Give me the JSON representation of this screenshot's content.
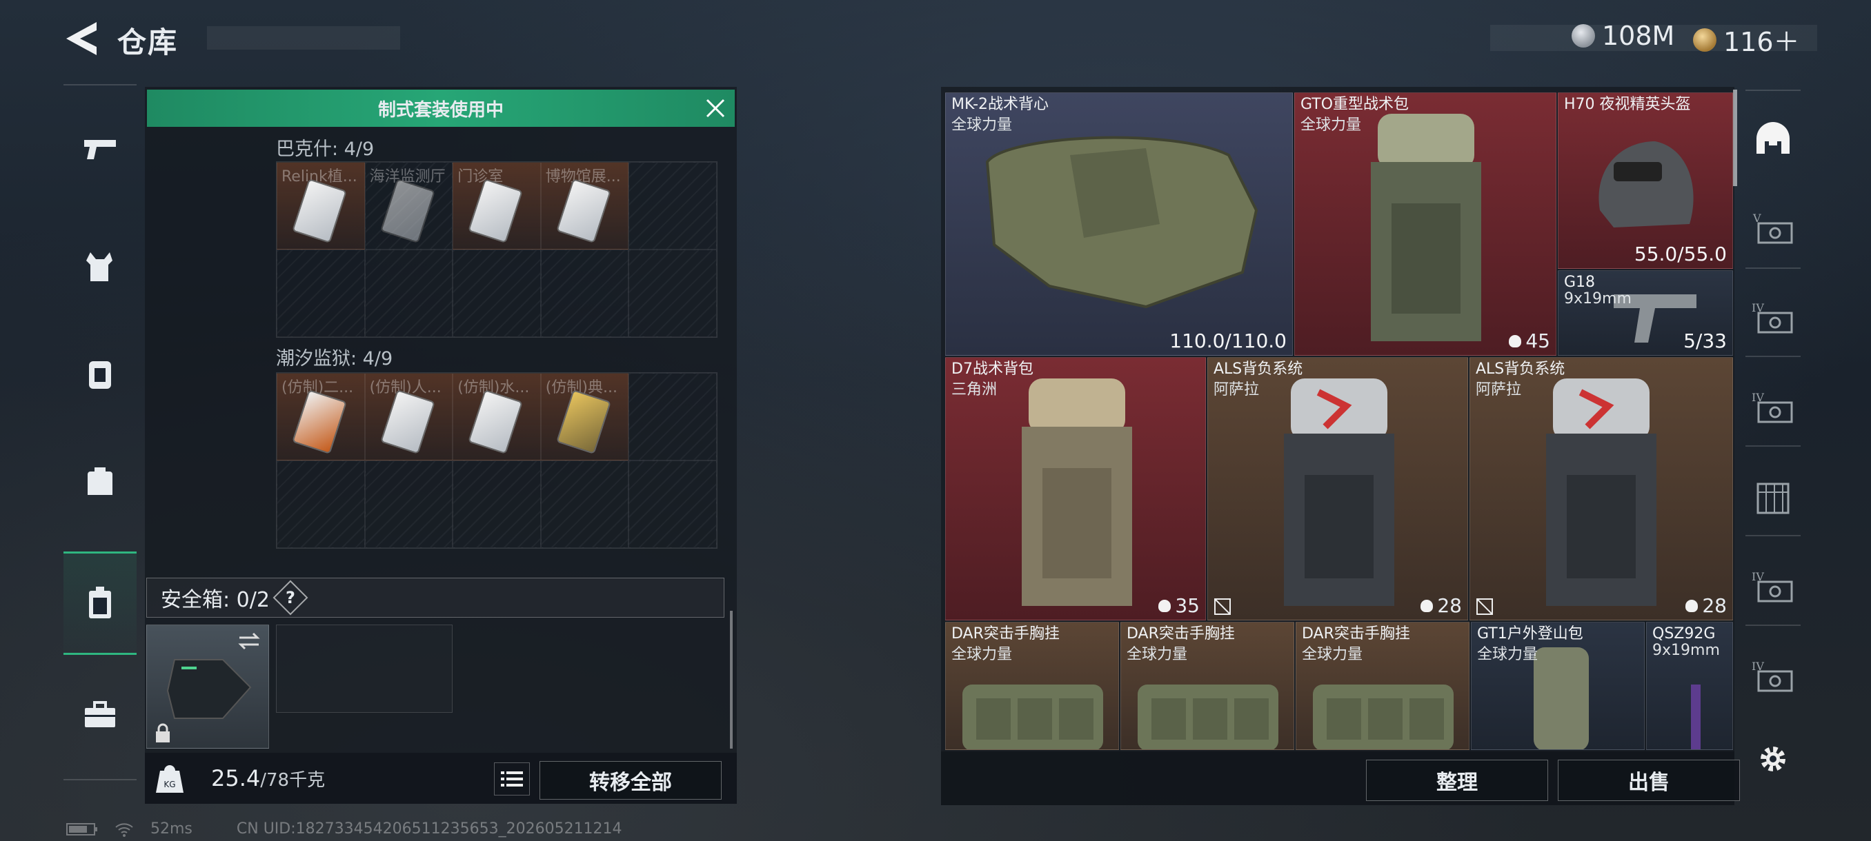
{
  "header": {
    "title": "仓库"
  },
  "currency": {
    "silver": "108M",
    "gold": "116＋"
  },
  "left_rail": [
    "gun-icon",
    "vest-icon",
    "rig-icon",
    "backpack-icon",
    "safe-case-icon",
    "toolbox-icon"
  ],
  "left_panel": {
    "banner": "制式套装使用中",
    "groups": [
      {
        "label": "巴克什: 4/9",
        "items": [
          "Relink植...",
          "海洋监测厅",
          "门诊室",
          "博物馆展..."
        ]
      },
      {
        "label": "潮汐监狱: 4/9",
        "items": [
          "(仿制)二...",
          "(仿制)人...",
          "(仿制)水...",
          "(仿制)典..."
        ]
      }
    ],
    "safe_box": {
      "label": "安全箱: 0/2",
      "help": "?"
    },
    "weight": {
      "current": "25.4",
      "max": "/78千克"
    },
    "transfer_button": "转移全部"
  },
  "right_panel": {
    "items": [
      {
        "name": "MK-2战术背心",
        "sub": "全球力量",
        "value": "110.0/110.0"
      },
      {
        "name": "GTO重型战术包",
        "sub": "全球力量",
        "value": "45"
      },
      {
        "name": "H70 夜视精英头盔",
        "sub": "",
        "value": "55.0/55.0"
      },
      {
        "name": "G18",
        "sub": "9x19mm",
        "value": "5/33"
      },
      {
        "name": "D7战术背包",
        "sub": "三角洲",
        "value": "35"
      },
      {
        "name": "ALS背负系统",
        "sub": "阿萨拉",
        "value": "28"
      },
      {
        "name": "ALS背负系统",
        "sub": "阿萨拉",
        "value": "28"
      },
      {
        "name": "DAR突击手胸挂",
        "sub": "全球力量",
        "value": ""
      },
      {
        "name": "DAR突击手胸挂",
        "sub": "全球力量",
        "value": ""
      },
      {
        "name": "DAR突击手胸挂",
        "sub": "全球力量",
        "value": ""
      },
      {
        "name": "GT1户外登山包",
        "sub": "全球力量",
        "value": ""
      },
      {
        "name": "QSZ92G",
        "sub": "9x19mm",
        "value": ""
      }
    ],
    "sort_button": "整理",
    "sell_button": "出售"
  },
  "right_rail": [
    "helmet-icon",
    "roman-V-case-icon",
    "roman-IV-case-icon",
    "roman-IV-case-icon",
    "grid-case-icon",
    "roman-IV-case-icon",
    "roman-IV-case-icon",
    "gear-icon"
  ],
  "status_bar": {
    "ping": "52ms",
    "uid": "CN UID:182733454206511235653_202605211214"
  },
  "colors": {
    "accent_green": "#27a676",
    "tile_red": "#7a2c33",
    "tile_blue": "#3f4660",
    "tile_brown": "#5c4635"
  }
}
